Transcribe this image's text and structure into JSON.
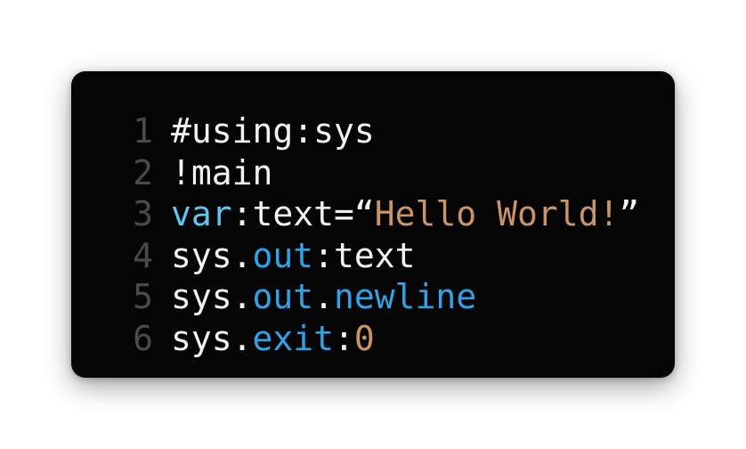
{
  "colors": {
    "background": "#050505",
    "line_number": "#4a4a4a",
    "plain": "#f2f2f2",
    "keyword": "#5fc4f0",
    "member": "#2ea3e8",
    "string": "#c89468",
    "number": "#c89468"
  },
  "editor": {
    "lines": [
      {
        "number": "1",
        "tokens": [
          {
            "text": "#using:sys",
            "kind": "plain"
          }
        ]
      },
      {
        "number": "2",
        "tokens": [
          {
            "text": "!main",
            "kind": "plain"
          }
        ]
      },
      {
        "number": "3",
        "tokens": [
          {
            "text": "var",
            "kind": "keyword"
          },
          {
            "text": ":text=“",
            "kind": "plain"
          },
          {
            "text": "Hello World!",
            "kind": "string"
          },
          {
            "text": "”",
            "kind": "plain"
          }
        ]
      },
      {
        "number": "4",
        "tokens": [
          {
            "text": "sys.",
            "kind": "plain"
          },
          {
            "text": "out",
            "kind": "member"
          },
          {
            "text": ":text",
            "kind": "plain"
          }
        ]
      },
      {
        "number": "5",
        "tokens": [
          {
            "text": "sys.",
            "kind": "plain"
          },
          {
            "text": "out",
            "kind": "member"
          },
          {
            "text": ".",
            "kind": "plain"
          },
          {
            "text": "newline",
            "kind": "member"
          }
        ]
      },
      {
        "number": "6",
        "tokens": [
          {
            "text": "sys.",
            "kind": "plain"
          },
          {
            "text": "exit",
            "kind": "member"
          },
          {
            "text": ":",
            "kind": "plain"
          },
          {
            "text": "0",
            "kind": "number"
          }
        ]
      }
    ]
  }
}
